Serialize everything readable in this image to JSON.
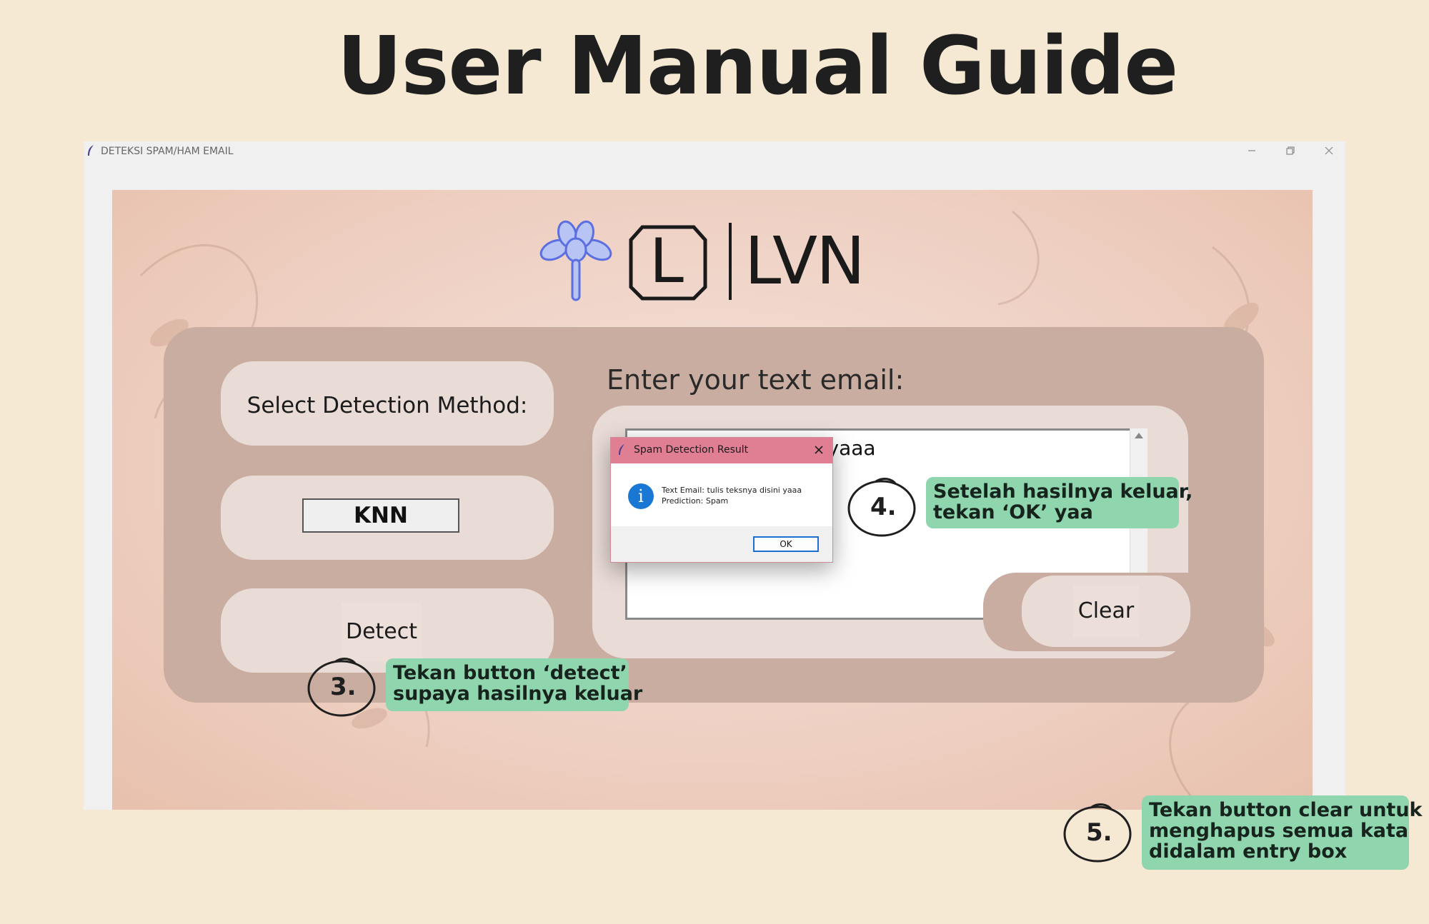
{
  "page": {
    "title": "User Manual Guide"
  },
  "window": {
    "title": "DETEKSI SPAM/HAM EMAIL",
    "minimize_icon": "minimize-icon",
    "restore_icon": "restore-icon",
    "close_icon": "close-icon"
  },
  "logo": {
    "brand": "LVN",
    "letter": "L",
    "flower_icon": "flower-icon"
  },
  "form": {
    "method_label": "Select Detection Method:",
    "method_value": "KNN",
    "detect_label": "Detect",
    "email_label": "Enter your text email:",
    "email_text": "tulis teksnya disini yaaa",
    "clear_label": "Clear"
  },
  "dialog": {
    "title": "Spam Detection Result",
    "icon": "info-icon",
    "line1": "Text Email: tulis teksnya disini yaaa",
    "line2": "Prediction: Spam",
    "ok_label": "OK"
  },
  "annotations": {
    "step3": {
      "number": "3.",
      "line1": "Tekan button ‘detect’",
      "line2": "supaya hasilnya keluar"
    },
    "step4": {
      "number": "4.",
      "line1": "Setelah hasilnya keluar,",
      "line2": "tekan ‘OK’ yaa"
    },
    "step5": {
      "number": "5.",
      "line1": "Tekan button clear untuk",
      "line2": "menghapus semua kata",
      "line3": "didalam entry box"
    }
  },
  "colors": {
    "page_bg": "#f6e9d3",
    "panel": "#c9ada1",
    "pill": "#e9dcd7",
    "dialog_titlebar": "#e07f93",
    "callout": "#8fd6ae",
    "info_blue": "#1a78d4"
  }
}
